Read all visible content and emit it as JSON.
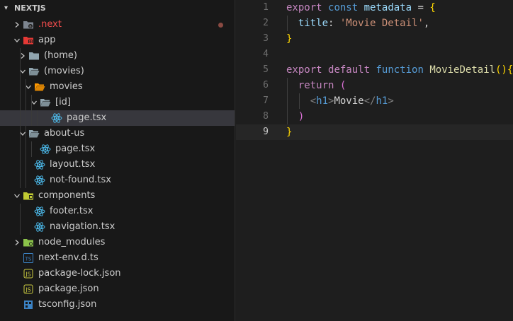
{
  "explorer": {
    "title": "NEXTJS",
    "items": [
      {
        "label": ".next",
        "type": "folder",
        "expanded": false,
        "icon": "next-folder-icon",
        "color": "#f14c4c",
        "modified": true
      },
      {
        "label": "app",
        "type": "folder",
        "expanded": true,
        "icon": "app-folder-icon"
      },
      {
        "label": "(home)",
        "type": "folder",
        "expanded": false,
        "icon": "folder-icon"
      },
      {
        "label": "(movies)",
        "type": "folder",
        "expanded": true,
        "icon": "folder-open-icon"
      },
      {
        "label": "movies",
        "type": "folder",
        "expanded": true,
        "icon": "movies-folder-icon"
      },
      {
        "label": "[id]",
        "type": "folder",
        "expanded": true,
        "icon": "folder-open-icon"
      },
      {
        "label": "page.tsx",
        "type": "file",
        "icon": "react-icon",
        "selected": true
      },
      {
        "label": "about-us",
        "type": "folder",
        "expanded": true,
        "icon": "folder-open-icon"
      },
      {
        "label": "page.tsx",
        "type": "file",
        "icon": "react-icon"
      },
      {
        "label": "layout.tsx",
        "type": "file",
        "icon": "react-icon"
      },
      {
        "label": "not-found.tsx",
        "type": "file",
        "icon": "react-icon"
      },
      {
        "label": "components",
        "type": "folder",
        "expanded": true,
        "icon": "components-folder-icon"
      },
      {
        "label": "footer.tsx",
        "type": "file",
        "icon": "react-icon"
      },
      {
        "label": "navigation.tsx",
        "type": "file",
        "icon": "react-icon"
      },
      {
        "label": "node_modules",
        "type": "folder",
        "expanded": false,
        "icon": "node-modules-folder-icon"
      },
      {
        "label": "next-env.d.ts",
        "type": "file",
        "icon": "typescript-icon"
      },
      {
        "label": "package-lock.json",
        "type": "file",
        "icon": "json-icon"
      },
      {
        "label": "package.json",
        "type": "file",
        "icon": "json-icon"
      },
      {
        "label": "tsconfig.json",
        "type": "file",
        "icon": "tsconfig-icon"
      }
    ]
  },
  "editor": {
    "current_line": 9,
    "lines": [
      {
        "number": "1",
        "tokens": [
          [
            "export",
            "t-kw"
          ],
          [
            " ",
            "t-plain"
          ],
          [
            "const",
            "t-kw2"
          ],
          [
            " metadata ",
            "t-id"
          ],
          [
            "=",
            "t-plain"
          ],
          [
            " ",
            "t-plain"
          ],
          [
            "{",
            "t-br1"
          ]
        ]
      },
      {
        "number": "2",
        "tokens": [
          [
            "  ",
            "t-plain"
          ],
          [
            "title",
            "t-key"
          ],
          [
            ": ",
            "t-plain"
          ],
          [
            "'Movie Detail'",
            "t-str"
          ],
          [
            ",",
            "t-plain"
          ]
        ]
      },
      {
        "number": "3",
        "tokens": [
          [
            "}",
            "t-br1"
          ]
        ]
      },
      {
        "number": "4",
        "tokens": []
      },
      {
        "number": "5",
        "tokens": [
          [
            "export",
            "t-kw"
          ],
          [
            " ",
            "t-plain"
          ],
          [
            "default",
            "t-kw"
          ],
          [
            " ",
            "t-plain"
          ],
          [
            "function",
            "t-kw2"
          ],
          [
            " ",
            "t-plain"
          ],
          [
            "MovieDetail",
            "t-fn"
          ],
          [
            "()",
            "t-br1"
          ],
          [
            "{",
            "t-br1"
          ]
        ]
      },
      {
        "number": "6",
        "tokens": [
          [
            "  ",
            "t-plain"
          ],
          [
            "return",
            "t-kw"
          ],
          [
            " ",
            "t-plain"
          ],
          [
            "(",
            "t-br2"
          ]
        ]
      },
      {
        "number": "7",
        "tokens": [
          [
            "    ",
            "t-plain"
          ],
          [
            "<",
            "t-tagbr"
          ],
          [
            "h1",
            "t-tag"
          ],
          [
            ">",
            "t-tagbr"
          ],
          [
            "Movie",
            "t-plain"
          ],
          [
            "</",
            "t-tagbr"
          ],
          [
            "h1",
            "t-tag"
          ],
          [
            ">",
            "t-tagbr"
          ]
        ]
      },
      {
        "number": "8",
        "tokens": [
          [
            "  ",
            "t-plain"
          ],
          [
            ")",
            "t-br2"
          ]
        ]
      },
      {
        "number": "9",
        "tokens": [
          [
            "}",
            "t-br1"
          ]
        ]
      }
    ]
  }
}
